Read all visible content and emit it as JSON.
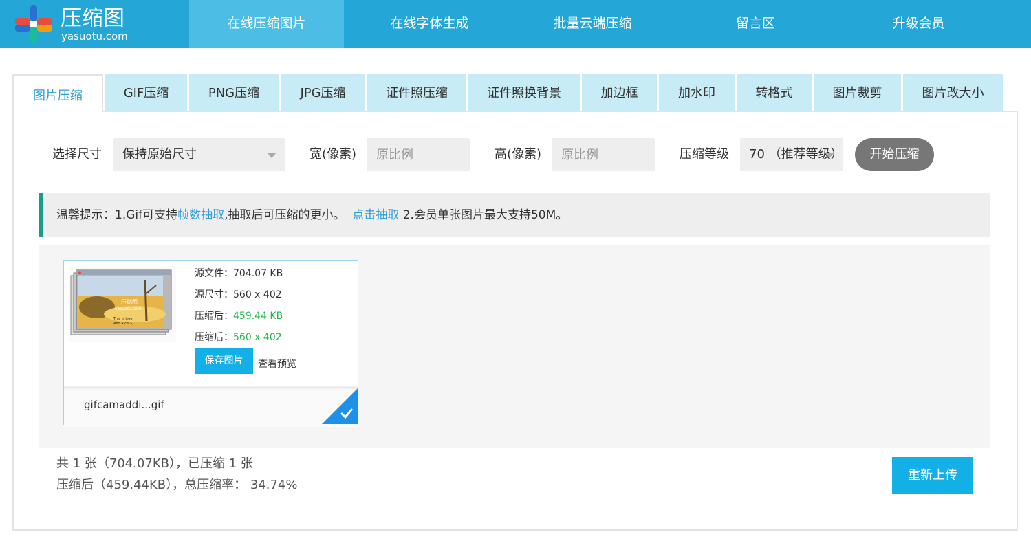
{
  "brand": {
    "title": "压缩图",
    "subtitle": "yasuotu.com"
  },
  "nav": [
    "在线压缩图片",
    "在线字体生成",
    "批量云端压缩",
    "留言区",
    "升级会员"
  ],
  "tabs": [
    "图片压缩",
    "GIF压缩",
    "PNG压缩",
    "JPG压缩",
    "证件照压缩",
    "证件照换背景",
    "加边框",
    "加水印",
    "转格式",
    "图片裁剪",
    "图片改大小"
  ],
  "controls": {
    "size_label": "选择尺寸",
    "size_value": "保持原始尺寸",
    "width_label": "宽(像素)",
    "width_placeholder": "原比例",
    "height_label": "高(像素)",
    "height_placeholder": "原比例",
    "level_label": "压缩等级",
    "level_value": "70 （推荐等级）",
    "start_button": "开始压缩"
  },
  "tip": {
    "prefix": "温馨提示：1.Gif可支持",
    "link1": "帧数抽取",
    "middle": ",抽取后可压缩的更小。",
    "link2": "点击抽取",
    "suffix": "2.会员单张图片最大支持50M。"
  },
  "file": {
    "source_size_label": "源文件：",
    "source_size": "704.07 KB",
    "source_dim_label": "源尺寸：",
    "source_dim": "560 x 402",
    "compressed_size_label": "压缩后：",
    "compressed_size": "459.44 KB",
    "compressed_dim_label": "压缩后：",
    "compressed_dim": "560 x 402",
    "save_button": "保存图片",
    "preview_link": "查看预览",
    "name": "gifcamaddi...gif",
    "thumb_watermark": "压缩图",
    "thumb_watermark_url": "yasuotu.com",
    "thumb_text1": "This is tree",
    "thumb_text2": "And Rice :-)"
  },
  "summary": {
    "line1": "共 1 张（704.07KB），已压缩 1 张",
    "line2": "压缩后（459.44KB），总压缩率： 34.74%"
  },
  "reupload_button": "重新上传",
  "colors": {
    "header": "#24a6d6",
    "nav_active": "#4cbde4",
    "tab_inactive": "#c8ecf6",
    "link": "#2b9fd8",
    "accent_button": "#12b0e6",
    "success": "#22b84a",
    "tip_border": "#1a9c8c",
    "logo_red": "#e94b3c",
    "logo_blue": "#2b6fd0",
    "logo_teal": "#1abc9c",
    "logo_orange": "#f39c12"
  }
}
